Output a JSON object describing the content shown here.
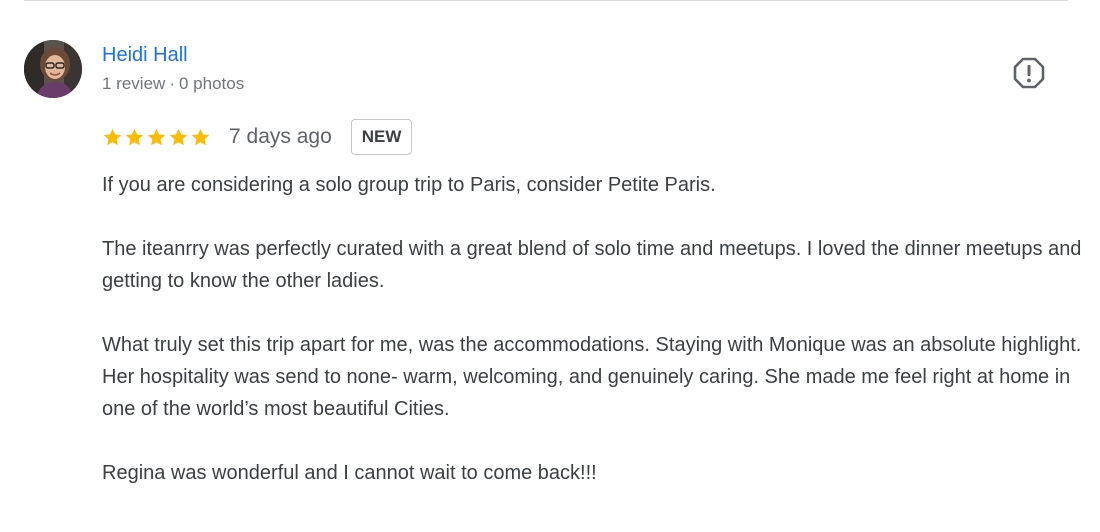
{
  "review": {
    "author": {
      "name": "Heidi Hall",
      "review_count": "1 review",
      "separator": "·",
      "photo_count": "0 photos",
      "avatar_icon": "user-avatar"
    },
    "report_icon": "report-flag-icon",
    "rating": {
      "stars": 5,
      "max": 5,
      "star_color": "#fbbc04"
    },
    "date": "7 days ago",
    "badge": "NEW",
    "paragraphs": [
      "If you are considering a solo group trip to Paris, consider Petite Paris.",
      "The iteanrry was perfectly curated with a great blend of solo time and meetups. I loved the dinner meetups and getting to know the other ladies.",
      "What truly set this trip apart for me, was the accommodations. Staying with Monique was an absolute highlight. Her hospitality was send to none- warm, welcoming, and genuinely caring. She made me feel right at home in one of the world’s most beautiful Cities.",
      "Regina was wonderful and I cannot wait to come back!!!"
    ]
  },
  "colors": {
    "link": "#1a73e8",
    "meta": "#70757a",
    "text": "#3c4043"
  }
}
